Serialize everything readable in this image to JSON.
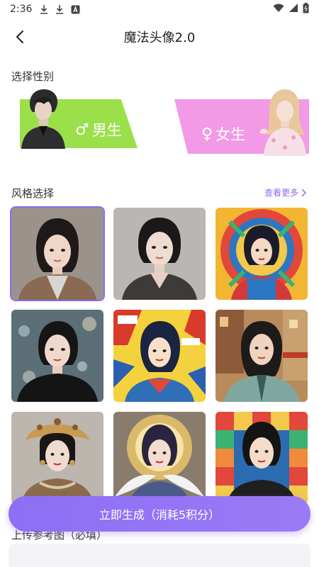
{
  "status_bar": {
    "time": "2:36",
    "icons": [
      "download-icon",
      "download-icon",
      "font-icon"
    ],
    "right_icons": [
      "wifi-icon",
      "signal-icon",
      "battery-icon"
    ]
  },
  "nav": {
    "title": "魔法头像2.0",
    "back_icon": "chevron-left-icon"
  },
  "gender": {
    "section_title": "选择性别",
    "male_label": "男生",
    "male_symbol": "♂",
    "female_label": "女生",
    "female_symbol": "♀",
    "colors": {
      "male": "#9be04a",
      "female": "#f29ae6"
    }
  },
  "style": {
    "section_title": "风格选择",
    "see_more": "查看更多",
    "tiles": [
      {
        "id": "realistic-beige",
        "selected": true
      },
      {
        "id": "realistic-grey",
        "selected": false
      },
      {
        "id": "folk-art-colorful",
        "selected": false
      },
      {
        "id": "bokeh-portrait",
        "selected": false
      },
      {
        "id": "comic-pop",
        "selected": false
      },
      {
        "id": "street-market",
        "selected": false
      },
      {
        "id": "jeweled-headdress",
        "selected": false
      },
      {
        "id": "angel-halo",
        "selected": false
      },
      {
        "id": "geometric-mosaic",
        "selected": false
      }
    ]
  },
  "cta": {
    "label": "立即生成（消耗5积分）"
  },
  "upload": {
    "label": "上传参考图（必填）"
  },
  "accent_color": "#8a6cf0"
}
